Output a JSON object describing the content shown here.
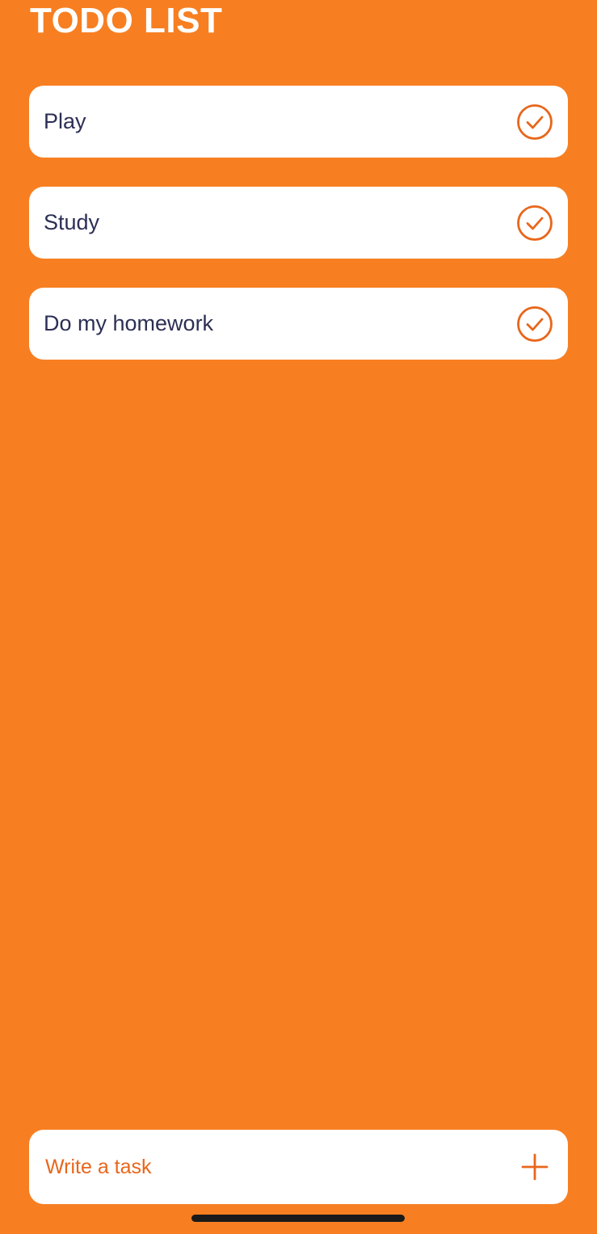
{
  "header": {
    "title": "TODO LIST"
  },
  "tasks": [
    {
      "label": "Play",
      "icon": "check-circle-icon"
    },
    {
      "label": "Study",
      "icon": "check-circle-icon"
    },
    {
      "label": "Do my homework",
      "icon": "check-circle-icon"
    }
  ],
  "composer": {
    "placeholder": "Write a task",
    "value": "",
    "add_icon": "plus-icon"
  },
  "colors": {
    "background": "#f77f22",
    "card": "#ffffff",
    "accent": "#e8661b",
    "task_text": "#2c2f55"
  }
}
